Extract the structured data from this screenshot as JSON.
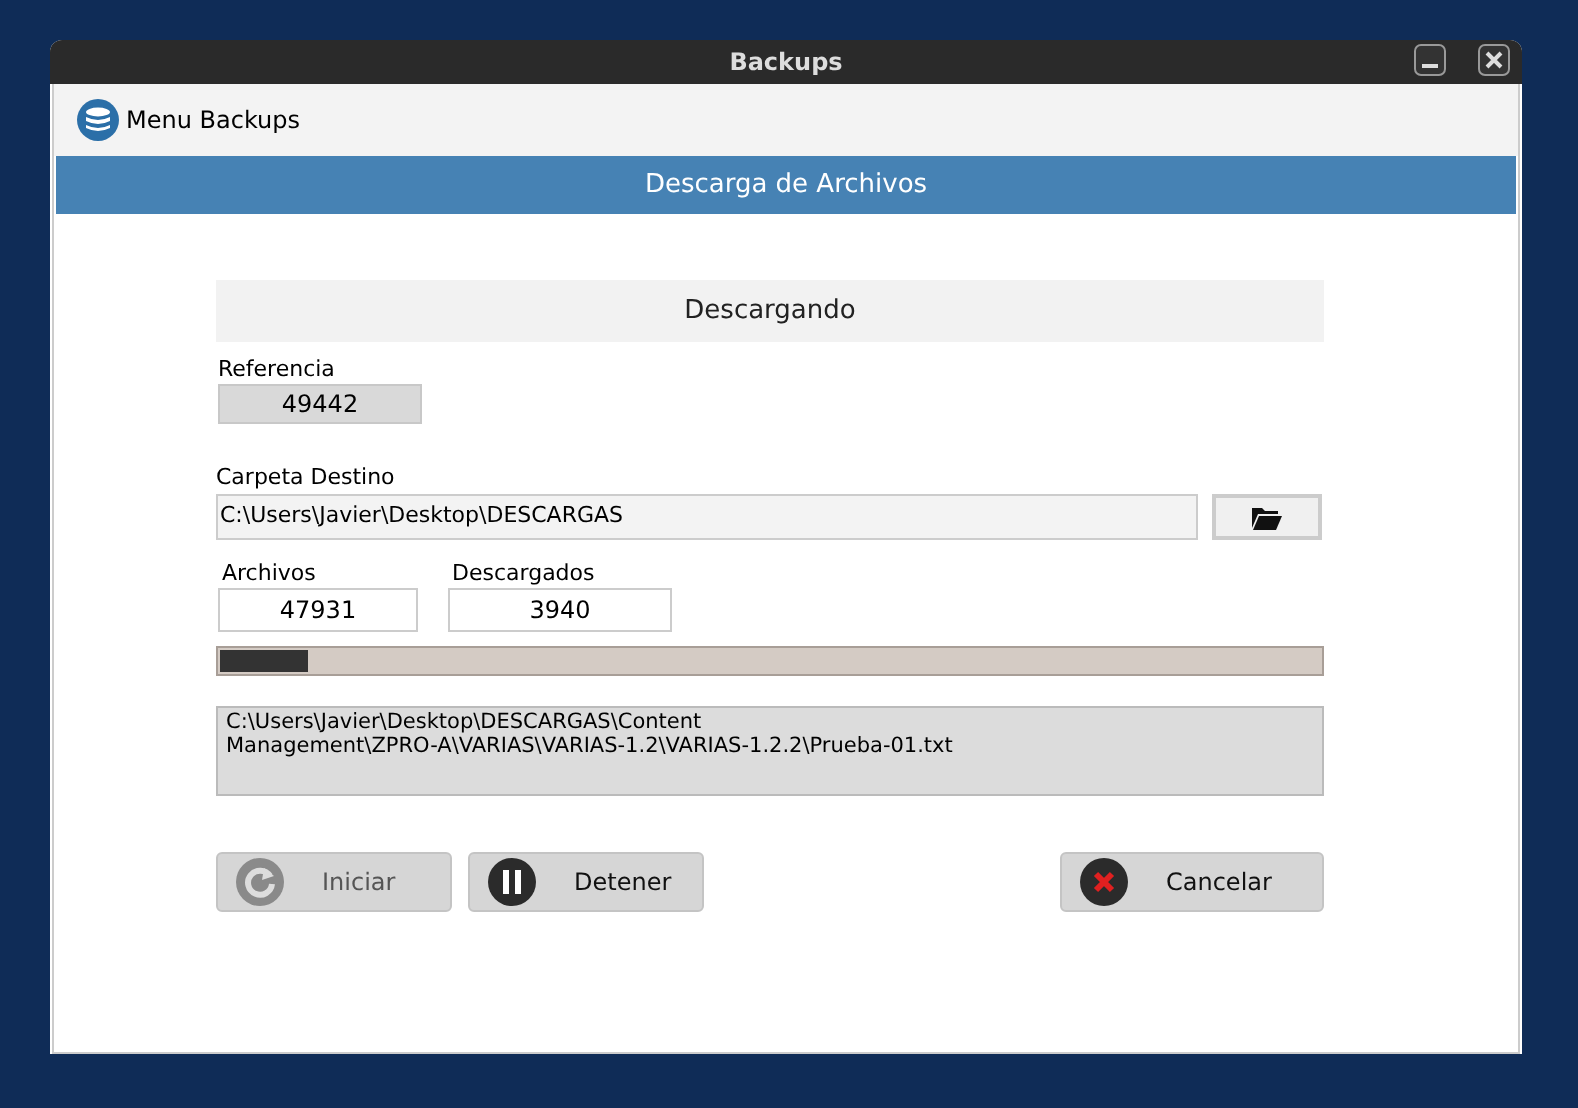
{
  "window": {
    "title": "Backups"
  },
  "menu": {
    "label": "Menu Backups"
  },
  "header": {
    "title": "Descarga de Archivos"
  },
  "status": {
    "title": "Descargando"
  },
  "referencia": {
    "label": "Referencia",
    "value": "49442"
  },
  "carpeta": {
    "label": "Carpeta Destino",
    "value": "C:\\Users\\Javier\\Desktop\\DESCARGAS"
  },
  "archivos": {
    "label": "Archivos",
    "value": "47931"
  },
  "descargados": {
    "label": "Descargados",
    "value": "3940"
  },
  "progress": {
    "level": 0.08
  },
  "log": {
    "lines": [
      "C:\\Users\\Javier\\Desktop\\DESCARGAS\\Content",
      "Management\\ZPRO-A\\VARIAS\\VARIAS-1.2\\VARIAS-1.2.2\\Prueba-01.txt"
    ]
  },
  "buttons": [
    {
      "kind": "start",
      "label": "Iniciar",
      "disabled": true
    },
    {
      "kind": "stop",
      "label": "Detener",
      "disabled": false
    },
    {
      "kind": "cancel",
      "label": "Cancelar",
      "disabled": false
    }
  ]
}
